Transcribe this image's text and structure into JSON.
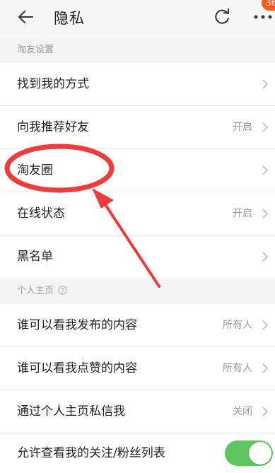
{
  "header": {
    "title": "隐私",
    "badge": "36",
    "back_icon": "arrow-left-icon",
    "refresh_icon": "refresh-icon",
    "more_icon": "more-dots-icon"
  },
  "sections": {
    "taoyou": {
      "title": "淘友设置",
      "rows": [
        {
          "label": "找到我的方式",
          "value": ""
        },
        {
          "label": "向我推荐好友",
          "value": "开启"
        },
        {
          "label": "淘友圈",
          "value": ""
        },
        {
          "label": "在线状态",
          "value": "开启"
        },
        {
          "label": "黑名单",
          "value": ""
        }
      ]
    },
    "profile": {
      "title": "个人主页",
      "rows": [
        {
          "label": "谁可以看我发布的内容",
          "value": "所有人"
        },
        {
          "label": "谁可以看我点赞的内容",
          "value": "所有人"
        },
        {
          "label": "通过个人主页私信我",
          "value": "关闭"
        },
        {
          "label": "允许查看我的关注/粉丝列表",
          "value": "",
          "toggle_on": true
        }
      ]
    }
  },
  "colors": {
    "accent_toggle": "#5fc55f",
    "badge": "#ff5a1f",
    "annotation_red": "#ee3b3b"
  }
}
